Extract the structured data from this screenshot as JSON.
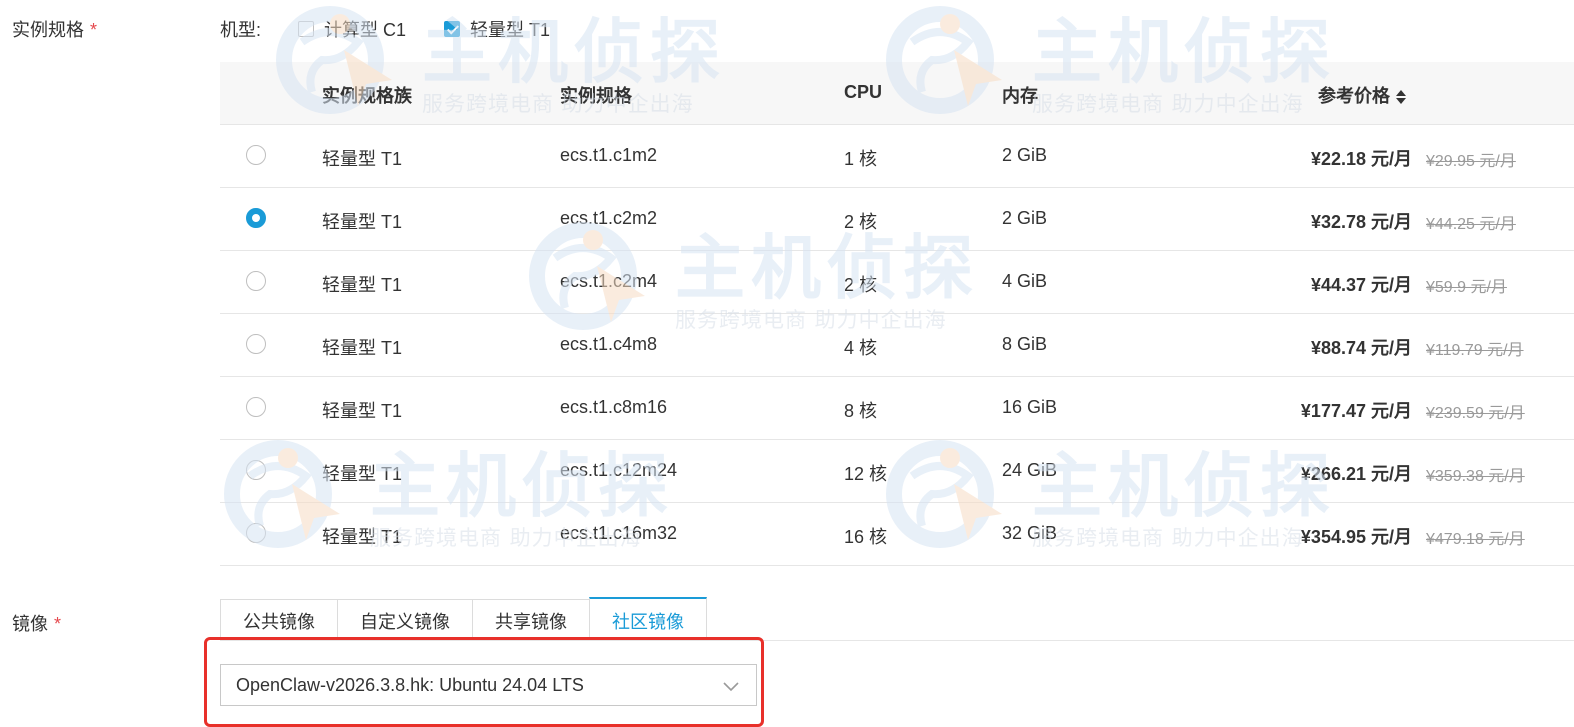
{
  "spec_section": {
    "label": "实例规格",
    "required_mark": "*",
    "type_filter": {
      "label": "机型:",
      "options": [
        {
          "label": "计算型 C1",
          "checked": false
        },
        {
          "label": "轻量型 T1",
          "checked": true
        }
      ]
    }
  },
  "table": {
    "headers": {
      "family": "实例规格族",
      "spec": "实例规格",
      "cpu": "CPU",
      "memory": "内存",
      "price": "参考价格"
    },
    "rows": [
      {
        "family": "轻量型 T1",
        "spec": "ecs.t1.c1m2",
        "cpu": "1 核",
        "memory": "2 GiB",
        "price": "¥22.18 元/月",
        "original_price": "¥29.95 元/月",
        "selected": false
      },
      {
        "family": "轻量型 T1",
        "spec": "ecs.t1.c2m2",
        "cpu": "2 核",
        "memory": "2 GiB",
        "price": "¥32.78 元/月",
        "original_price": "¥44.25 元/月",
        "selected": true
      },
      {
        "family": "轻量型 T1",
        "spec": "ecs.t1.c2m4",
        "cpu": "2 核",
        "memory": "4 GiB",
        "price": "¥44.37 元/月",
        "original_price": "¥59.9 元/月",
        "selected": false
      },
      {
        "family": "轻量型 T1",
        "spec": "ecs.t1.c4m8",
        "cpu": "4 核",
        "memory": "8 GiB",
        "price": "¥88.74 元/月",
        "original_price": "¥119.79 元/月",
        "selected": false
      },
      {
        "family": "轻量型 T1",
        "spec": "ecs.t1.c8m16",
        "cpu": "8 核",
        "memory": "16 GiB",
        "price": "¥177.47 元/月",
        "original_price": "¥239.59 元/月",
        "selected": false
      },
      {
        "family": "轻量型 T1",
        "spec": "ecs.t1.c12m24",
        "cpu": "12 核",
        "memory": "24 GiB",
        "price": "¥266.21 元/月",
        "original_price": "¥359.38 元/月",
        "selected": false
      },
      {
        "family": "轻量型 T1",
        "spec": "ecs.t1.c16m32",
        "cpu": "16 核",
        "memory": "32 GiB",
        "price": "¥354.95 元/月",
        "original_price": "¥479.18 元/月",
        "selected": false
      }
    ]
  },
  "image_section": {
    "label": "镜像",
    "required_mark": "*",
    "tabs": [
      {
        "label": "公共镜像",
        "active": false
      },
      {
        "label": "自定义镜像",
        "active": false
      },
      {
        "label": "共享镜像",
        "active": false
      },
      {
        "label": "社区镜像",
        "active": true
      }
    ],
    "selected_image": "OpenClaw-v2026.3.8.hk: Ubuntu 24.04 LTS"
  },
  "watermark": {
    "main": "主机侦探",
    "sub": "服务跨境电商  助力中企出海"
  },
  "colors": {
    "accent": "#1a9bd7",
    "required": "#e5484d",
    "highlight_border": "#e8302a",
    "header_bg": "#f7f7f7"
  }
}
